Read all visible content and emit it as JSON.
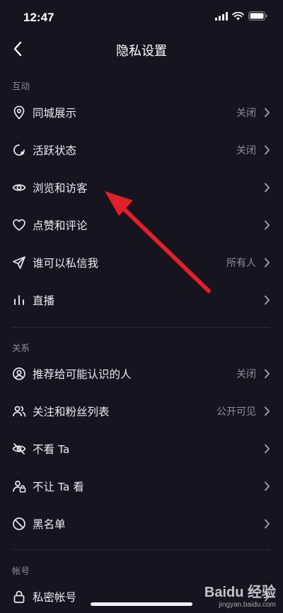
{
  "status_bar": {
    "time": "12:47"
  },
  "nav": {
    "title": "隐私设置"
  },
  "sections": {
    "interaction": {
      "header": "互动",
      "items": [
        {
          "label": "同城展示",
          "value": "关闭",
          "icon": "location-pin-icon"
        },
        {
          "label": "活跃状态",
          "value": "关闭",
          "icon": "activity-status-icon"
        },
        {
          "label": "浏览和访客",
          "value": "",
          "icon": "eye-icon"
        },
        {
          "label": "点赞和评论",
          "value": "",
          "icon": "heart-icon"
        },
        {
          "label": "谁可以私信我",
          "value": "所有人",
          "icon": "send-icon"
        },
        {
          "label": "直播",
          "value": "",
          "icon": "live-bars-icon"
        }
      ]
    },
    "relations": {
      "header": "关系",
      "items": [
        {
          "label": "推荐给可能认识的人",
          "value": "关闭",
          "icon": "user-circle-icon"
        },
        {
          "label": "关注和粉丝列表",
          "value": "公开可见",
          "icon": "users-icon"
        },
        {
          "label": "不看 Ta",
          "value": "",
          "icon": "eye-off-icon"
        },
        {
          "label": "不让 Ta 看",
          "value": "",
          "icon": "user-lock-icon"
        },
        {
          "label": "黑名单",
          "value": "",
          "icon": "block-icon"
        }
      ]
    },
    "account": {
      "header": "帐号",
      "items": [
        {
          "label": "私密帐号",
          "value": "",
          "icon": "lock-icon"
        }
      ]
    }
  },
  "watermark": {
    "logo": "Baidu 经验",
    "sub": "jingyan.baidu.com"
  },
  "colors": {
    "background": "#16141f",
    "annotation_arrow": "#e0202a"
  }
}
